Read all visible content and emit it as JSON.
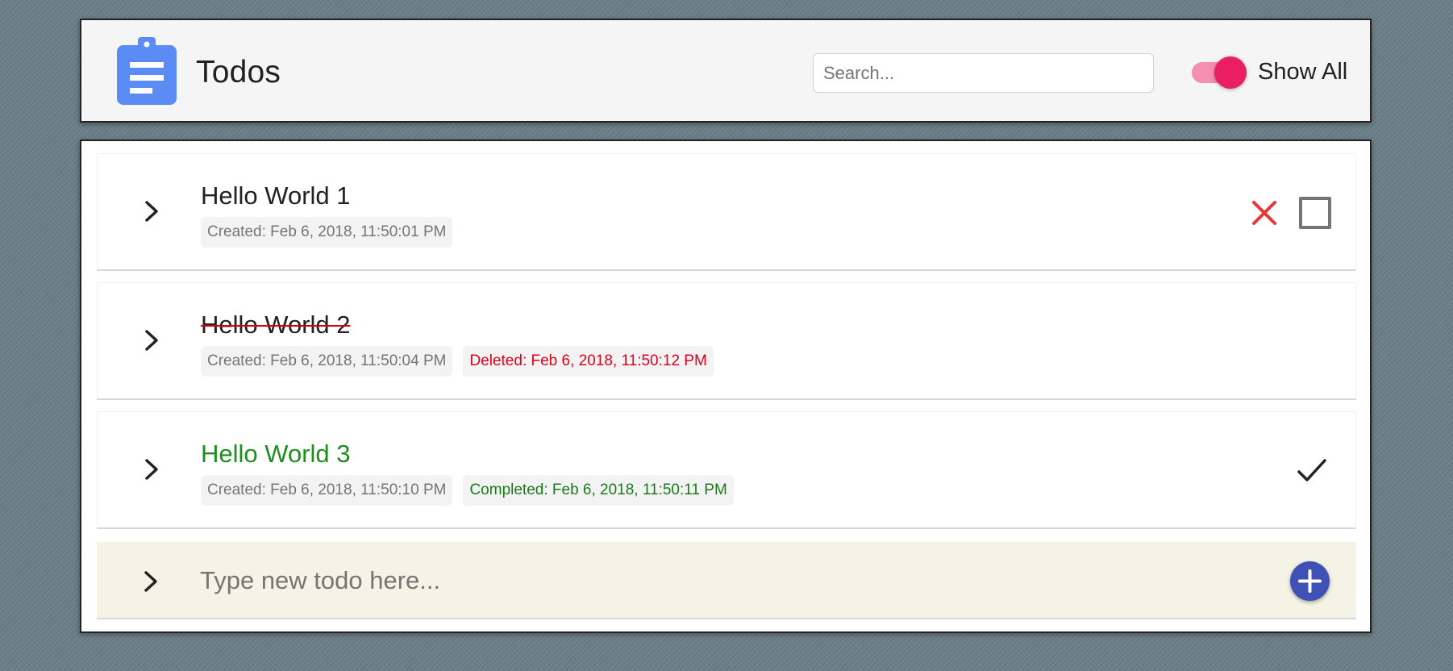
{
  "app": {
    "title": "Todos",
    "logo_icon": "clipboard-icon",
    "logo_color": "#5b8cf5"
  },
  "search": {
    "placeholder": "Search...",
    "value": ""
  },
  "toggle": {
    "label": "Show All",
    "checked": true,
    "accent": "#e91e63"
  },
  "todos": [
    {
      "title": "Hello World 1",
      "status": "active",
      "created": "Created: Feb 6, 2018, 11:50:01 PM"
    },
    {
      "title": "Hello World 2",
      "status": "deleted",
      "created": "Created: Feb 6, 2018, 11:50:04 PM",
      "deleted": "Deleted: Feb 6, 2018, 11:50:12 PM"
    },
    {
      "title": "Hello World 3",
      "status": "completed",
      "created": "Created: Feb 6, 2018, 11:50:10 PM",
      "completed": "Completed: Feb 6, 2018, 11:50:11 PM"
    }
  ],
  "new_todo": {
    "placeholder": "Type new todo here...",
    "value": ""
  },
  "colors": {
    "deleted": "#e0001a",
    "completed": "#1e8e1e",
    "add_button": "#3f51b5",
    "new_row_bg": "#f5f3e6"
  },
  "icons": {
    "expand": "chevron-right-icon",
    "delete": "close-icon",
    "complete_box": "checkbox-icon",
    "completed": "checkmark-icon",
    "add": "plus-icon"
  }
}
